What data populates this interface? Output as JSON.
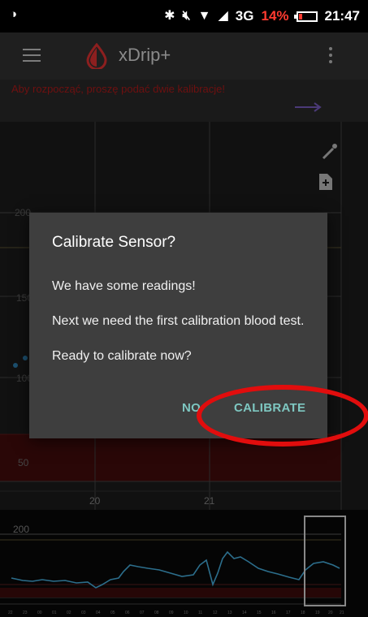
{
  "status_bar": {
    "left_icon": "notification-dot-icon",
    "network": "3G",
    "battery_percent": "14%",
    "time": "21:47"
  },
  "app_bar": {
    "title": "xDrip+",
    "notice": "Aby rozpocząć, proszę podać dwie kalibracje!"
  },
  "chart": {
    "y_labels": [
      "200",
      "150",
      "100",
      "50"
    ],
    "x_labels": [
      "20",
      "21"
    ]
  },
  "mini_chart": {
    "y_label": "200",
    "x_ticks": [
      "22",
      "23",
      "00",
      "01",
      "02",
      "03",
      "04",
      "05",
      "06",
      "07",
      "08",
      "09",
      "10",
      "11",
      "12",
      "13",
      "14",
      "15",
      "16",
      "17",
      "18",
      "19",
      "20",
      "21"
    ]
  },
  "dialog": {
    "title": "Calibrate Sensor?",
    "messages": [
      "We have some readings!",
      "Next we need the first calibration blood test.",
      "Ready to calibrate now?"
    ],
    "negative_label": "NO",
    "positive_label": "CALIBRATE"
  },
  "colors": {
    "accent": "#7ec7c1",
    "highlight": "#e10d0d",
    "battery_low": "#ff3b30"
  }
}
